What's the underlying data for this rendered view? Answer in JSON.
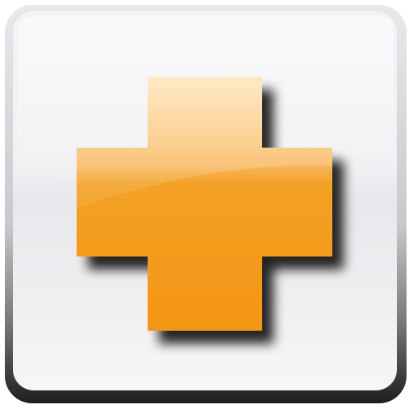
{
  "icon": {
    "name": "plus-icon",
    "colors": {
      "tile_background": "#f2f2f4",
      "tile_bottom_border": "#2a2a2a",
      "cross_orange": "#f39c1b",
      "cross_orange_light": "#ffd58f",
      "cross_shadow": "#3c3c3c"
    }
  }
}
